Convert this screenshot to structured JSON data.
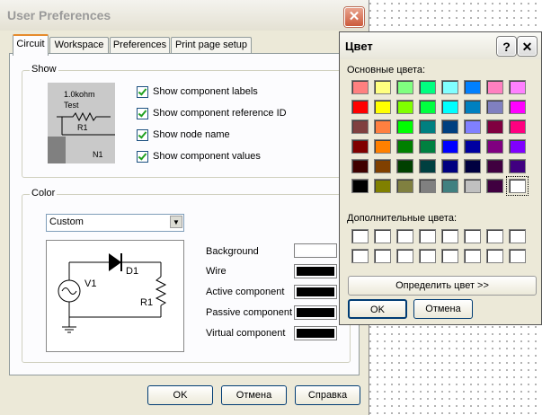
{
  "main_window": {
    "title": "User Preferences",
    "tabs": [
      "Circuit",
      "Workspace",
      "Preferences",
      "Print page setup"
    ],
    "show_group": {
      "label": "Show",
      "preview": {
        "value_text": "1.0kohm",
        "test_text": "Test",
        "ref_text": "R1",
        "node_text": "N1"
      },
      "checkboxes": [
        {
          "label": "Show component labels",
          "checked": true
        },
        {
          "label": "Show component reference ID",
          "checked": true
        },
        {
          "label": "Show node name",
          "checked": true
        },
        {
          "label": "Show component values",
          "checked": true
        }
      ]
    },
    "color_group": {
      "label": "Color",
      "scheme_value": "Custom",
      "schematic_labels": {
        "d1": "D1",
        "v1": "V1",
        "r1": "R1"
      },
      "colors": [
        {
          "label": "Background",
          "color": "#ffffff"
        },
        {
          "label": "Wire",
          "color": "#000000"
        },
        {
          "label": "Active component",
          "color": "#000000"
        },
        {
          "label": "Passive component",
          "color": "#000000"
        },
        {
          "label": "Virtual component",
          "color": "#000000"
        }
      ]
    },
    "buttons": {
      "ok": "OK",
      "cancel": "Отмена",
      "help": "Справка"
    }
  },
  "color_dialog": {
    "title": "Цвет",
    "help_glyph": "?",
    "basic_label": "Основные цвета:",
    "basic_colors": [
      "#ff8080",
      "#ffff80",
      "#80ff80",
      "#00ff80",
      "#80ffff",
      "#0080ff",
      "#ff80c0",
      "#ff80ff",
      "#ff0000",
      "#ffff00",
      "#80ff00",
      "#00ff40",
      "#00ffff",
      "#0080c0",
      "#8080c0",
      "#ff00ff",
      "#804040",
      "#ff8040",
      "#00ff00",
      "#008080",
      "#004080",
      "#8080ff",
      "#800040",
      "#ff0080",
      "#800000",
      "#ff8000",
      "#008000",
      "#008040",
      "#0000ff",
      "#0000a0",
      "#800080",
      "#8000ff",
      "#400000",
      "#804000",
      "#004000",
      "#004040",
      "#000080",
      "#000040",
      "#400040",
      "#400080",
      "#000000",
      "#808000",
      "#808040",
      "#808080",
      "#408080",
      "#c0c0c0",
      "#400040",
      "#ffffff"
    ],
    "selected_index": 47,
    "custom_label": "Дополнительные цвета:",
    "custom_colors": [
      "#ffffff",
      "#ffffff",
      "#ffffff",
      "#ffffff",
      "#ffffff",
      "#ffffff",
      "#ffffff",
      "#ffffff",
      "#ffffff",
      "#ffffff",
      "#ffffff",
      "#ffffff",
      "#ffffff",
      "#ffffff",
      "#ffffff",
      "#ffffff"
    ],
    "define_button": "Определить цвет >>",
    "ok_button": "OK",
    "cancel_button": "Отмена"
  }
}
